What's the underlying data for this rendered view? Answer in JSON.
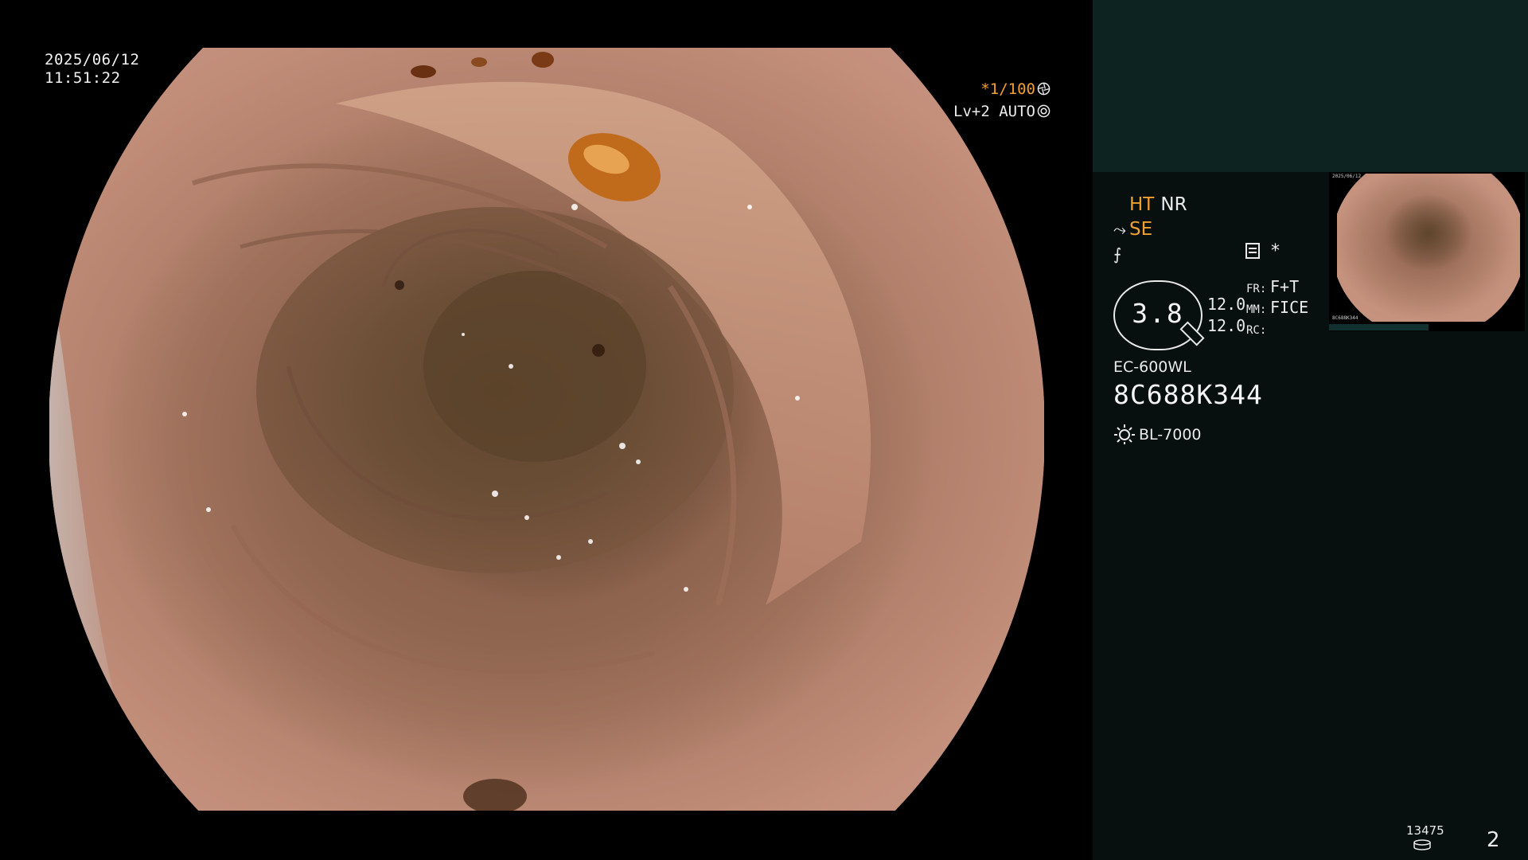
{
  "overlay": {
    "date": "2025/06/12",
    "time": "11:51:22",
    "shutter_speed": "*1/100",
    "brightness_level": "Lv+2",
    "iris_mode": "AUTO"
  },
  "status": {
    "ht": "HT",
    "nr": "NR",
    "se": "SE",
    "star": "*"
  },
  "gauge": {
    "value": "3.8",
    "line1": "12.0",
    "line2": "12.0"
  },
  "modes": {
    "fr_key": "FR:",
    "fr_val": "F+T",
    "mm_key": "MM:",
    "mm_val": "FICE",
    "rc_key": "RC:",
    "rc_val": ""
  },
  "scope": {
    "model": "EC-600WL",
    "serial": "8C688K344",
    "light_source": "BL-7000"
  },
  "footer": {
    "image_count": "13475",
    "page_number": "2"
  },
  "colors": {
    "accent_orange": "#f0a030",
    "panel_top": "#0c2322",
    "panel_bg": "#07100f"
  },
  "icons": {
    "shutter": "aperture-icon",
    "iris": "iris-icon",
    "light": "sun-icon",
    "storage": "disk-icon",
    "structure": "structure-enhance-icon",
    "freeze": "freeze-icon",
    "memo": "memo-icon"
  }
}
